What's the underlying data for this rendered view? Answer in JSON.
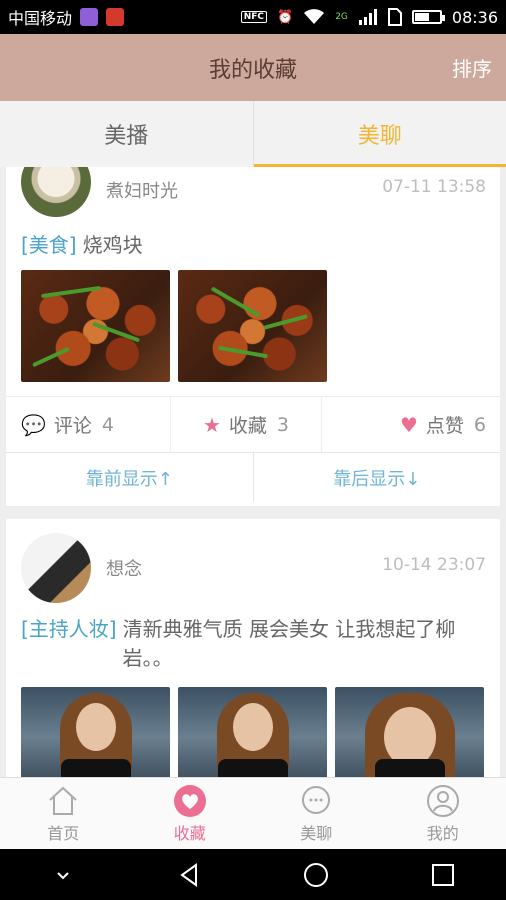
{
  "status_bar": {
    "carrier": "中国移动",
    "nfc": "NFC",
    "network": "2G",
    "battery_level": 0.55,
    "time": "08:36"
  },
  "header": {
    "title": "我的收藏",
    "sort_label": "排序"
  },
  "tabs": [
    {
      "label": "美播",
      "active": false
    },
    {
      "label": "美聊",
      "active": true
    }
  ],
  "posts": [
    {
      "username": "煮妇时光",
      "time": "07-11 13:58",
      "tag": "[美食]",
      "text": "烧鸡块",
      "actions": {
        "comment_label": "评论",
        "comment_count": "4",
        "favorite_label": "收藏",
        "favorite_count": "3",
        "like_label": "点赞",
        "like_count": "6"
      },
      "shift_forward": "靠前显示↑",
      "shift_backward": "靠后显示↓"
    },
    {
      "username": "想念",
      "time": "10-14 23:07",
      "tag": "[主持人妆]",
      "text": "清新典雅气质 展会美女 让我想起了柳岩。。"
    }
  ],
  "bottom_nav": [
    {
      "label": "首页",
      "icon": "home-icon",
      "active": false
    },
    {
      "label": "收藏",
      "icon": "heart-icon",
      "active": true
    },
    {
      "label": "美聊",
      "icon": "chat-icon",
      "active": false
    },
    {
      "label": "我的",
      "icon": "user-icon",
      "active": false
    }
  ],
  "colors": {
    "header_bg": "#cda89c",
    "accent_yellow": "#f2b632",
    "accent_pink": "#ec6f93",
    "tag_blue": "#4aa3c9"
  }
}
